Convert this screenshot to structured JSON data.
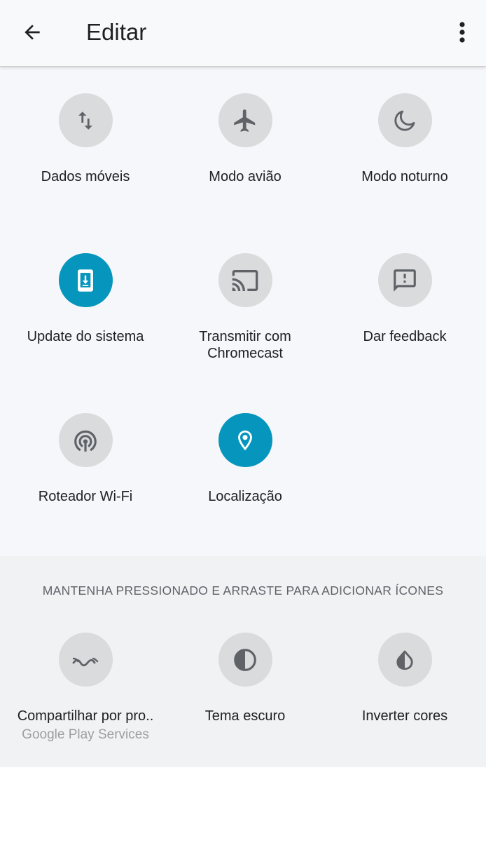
{
  "appbar": {
    "title": "Editar",
    "back_icon": "arrow-back-icon",
    "menu_icon": "more-vert-icon"
  },
  "colors": {
    "tile_off": "#dadbdd",
    "tile_on": "#0595bd",
    "icon_off": "#5f6368",
    "icon_on": "#ffffff"
  },
  "active_tiles": [
    {
      "label": "Dados móveis",
      "icon": "mobile-data-icon",
      "active": false
    },
    {
      "label": "Modo avião",
      "icon": "airplane-icon",
      "active": false
    },
    {
      "label": "Modo noturno",
      "icon": "moon-icon",
      "active": false
    },
    {
      "label": "Update do sistema",
      "icon": "system-update-icon",
      "active": true
    },
    {
      "label": "Transmitir com\nChromecast",
      "icon": "cast-icon",
      "active": false
    },
    {
      "label": "Dar feedback",
      "icon": "feedback-icon",
      "active": false
    },
    {
      "label": "Roteador Wi-Fi",
      "icon": "hotspot-icon",
      "active": false
    },
    {
      "label": "Localização",
      "icon": "location-pin-icon",
      "active": true
    }
  ],
  "available_section": {
    "header": "MANTENHA PRESSIONADO E ARRASTE PARA ADICIONAR ÍCONES",
    "tiles": [
      {
        "label": "Compartilhar por pro..",
        "sublabel": "Google Play Services",
        "icon": "nearby-share-icon"
      },
      {
        "label": "Tema escuro",
        "icon": "dark-theme-icon"
      },
      {
        "label": "Inverter cores",
        "icon": "invert-colors-icon"
      }
    ]
  }
}
